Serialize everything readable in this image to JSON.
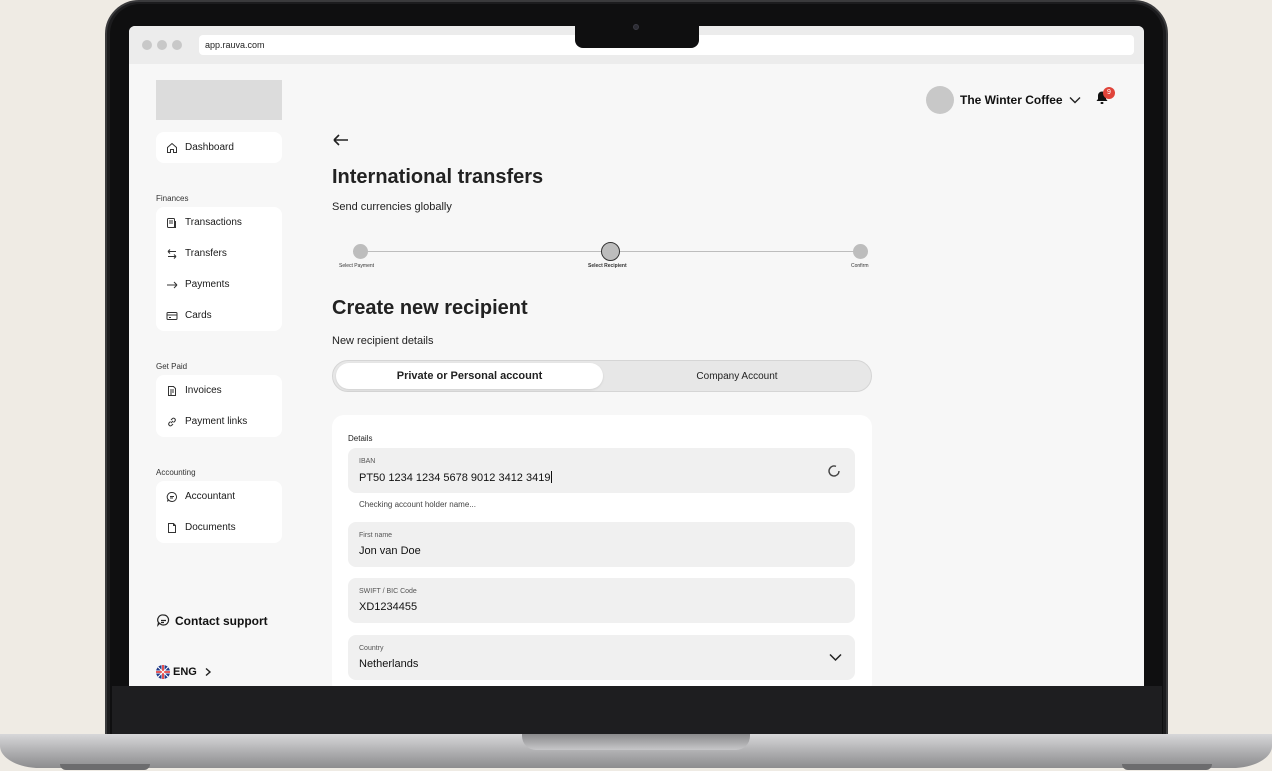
{
  "browser": {
    "url": "app.rauva.com"
  },
  "sidebar": {
    "dashboard": "Dashboard",
    "finances_label": "Finances",
    "finances_items": [
      "Transactions",
      "Transfers",
      "Payments",
      "Cards"
    ],
    "getpaid_label": "Get Paid",
    "getpaid_items": [
      "Invoices",
      "Payment links"
    ],
    "accounting_label": "Accounting",
    "accounting_items": [
      "Accountant",
      "Documents"
    ],
    "support": "Contact support",
    "language": "ENG"
  },
  "header": {
    "company": "The Winter Coffee",
    "notifications": "9"
  },
  "page": {
    "title": "International transfers",
    "subtitle": "Send currencies globally"
  },
  "stepper": {
    "steps": [
      "Select Payment",
      "Select Recipient",
      "Confirm"
    ],
    "active_index": 1
  },
  "recipient": {
    "title": "Create new recipient",
    "subtitle": "New recipient details",
    "tabs": [
      "Private or Personal account",
      "Company Account"
    ],
    "details_label": "Details",
    "fields": {
      "iban_label": "IBAN",
      "iban_value": "PT50 1234 1234 5678 9012 3412 3419",
      "iban_hint": "Checking account holder name...",
      "first_name_label": "First name",
      "first_name_value": "Jon van Doe",
      "swift_label": "SWIFT / BIC Code",
      "swift_value": "XD1234455",
      "country_label": "Country",
      "country_value": "Netherlands"
    }
  },
  "colors": {
    "badge": "#e0443a",
    "field_bg": "#f0f0f0"
  }
}
